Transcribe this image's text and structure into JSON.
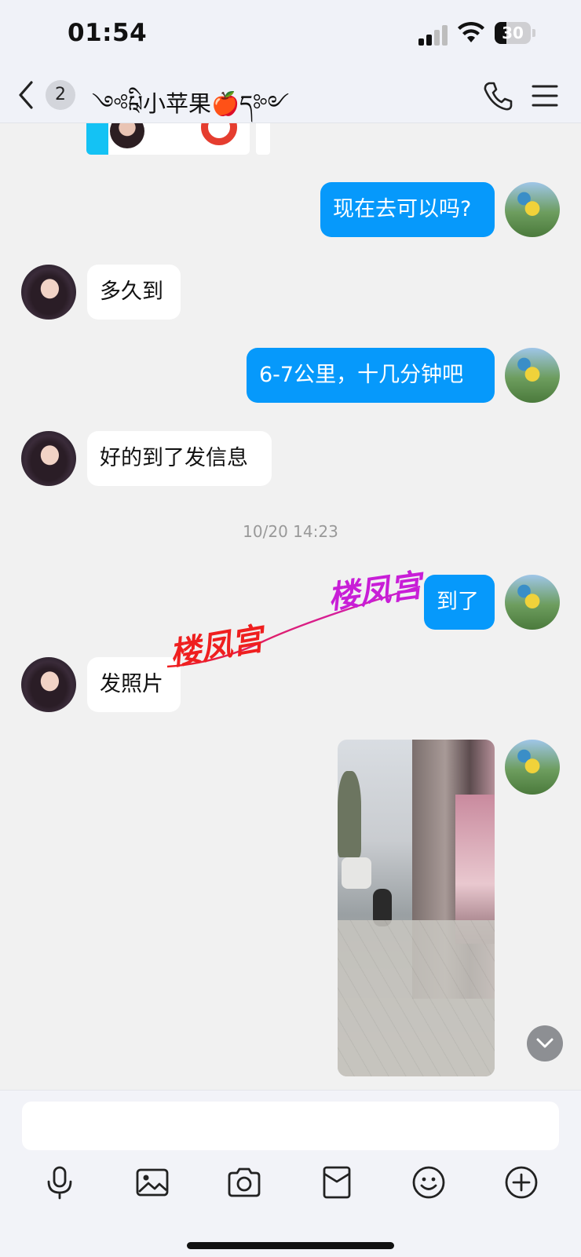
{
  "status_bar": {
    "time": "01:54",
    "battery_level": "30",
    "battery_fraction": 0.3
  },
  "header": {
    "unread_count": "2",
    "title": "༺ཱིཔ小苹果🍎ད༻"
  },
  "messages": [
    {
      "side": "out",
      "text": "现在去可以吗?"
    },
    {
      "side": "in",
      "text": "多久到"
    },
    {
      "side": "out",
      "text": "6-7公里，十几分钟吧"
    },
    {
      "side": "in",
      "text": "好的到了发信息"
    },
    {
      "side": "out",
      "text": "到了"
    },
    {
      "side": "in",
      "text": "发照片"
    }
  ],
  "timestamp": "10/20 14:23",
  "watermark": {
    "text_1": "楼凤宫",
    "text_2": "楼凤宫"
  },
  "composer": {
    "input_value": "",
    "tools": [
      "microphone-icon",
      "image-icon",
      "camera-icon",
      "red-packet-icon",
      "emoji-icon",
      "plus-icon"
    ]
  },
  "colors": {
    "accent": "#0699fb",
    "incoming_bubble": "#ffffff",
    "background": "#f1f1f1"
  }
}
